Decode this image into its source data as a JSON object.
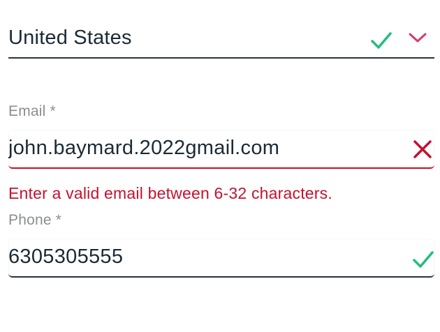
{
  "country": {
    "value": "United States",
    "valid_icon": "check-icon",
    "dropdown_icon": "chevron-down-icon"
  },
  "email": {
    "label": "Email *",
    "value": "john.baymard.2022gmail.com",
    "error_icon": "x-icon",
    "error_message": "Enter a valid email between 6-32 characters."
  },
  "phone": {
    "label": "Phone *",
    "value": "6305305555",
    "valid_icon": "check-icon"
  },
  "colors": {
    "text": "#1b2a36",
    "label": "#8a8e92",
    "error": "#c8102e",
    "valid": "#1fbf7a",
    "chevron": "#d63a6c",
    "border": "#2a3440"
  }
}
